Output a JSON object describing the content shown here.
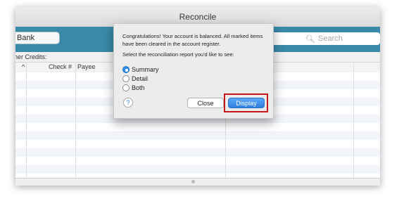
{
  "window": {
    "title": "Reconcile",
    "account_button": "Bank",
    "search_placeholder": "Search",
    "credits_label": "her Credits:",
    "columns": {
      "sort_indicator": "^",
      "check": "Check #",
      "payee": "Payee"
    }
  },
  "dialog": {
    "message": "Congratulations! Your account is balanced. All marked items have been cleared in the account register.",
    "prompt": "Select the reconciliation report you'd like to see:",
    "options": [
      {
        "label": "Summary",
        "selected": true
      },
      {
        "label": "Detail",
        "selected": false
      },
      {
        "label": "Both",
        "selected": false
      }
    ],
    "help_label": "?",
    "close_label": "Close",
    "display_label": "Display"
  },
  "icons": {
    "search": "search-icon",
    "help": "help-icon"
  },
  "colors": {
    "accent": "#2f7fe3",
    "highlight": "#c8161d",
    "toolbar": "#3a89a8"
  }
}
